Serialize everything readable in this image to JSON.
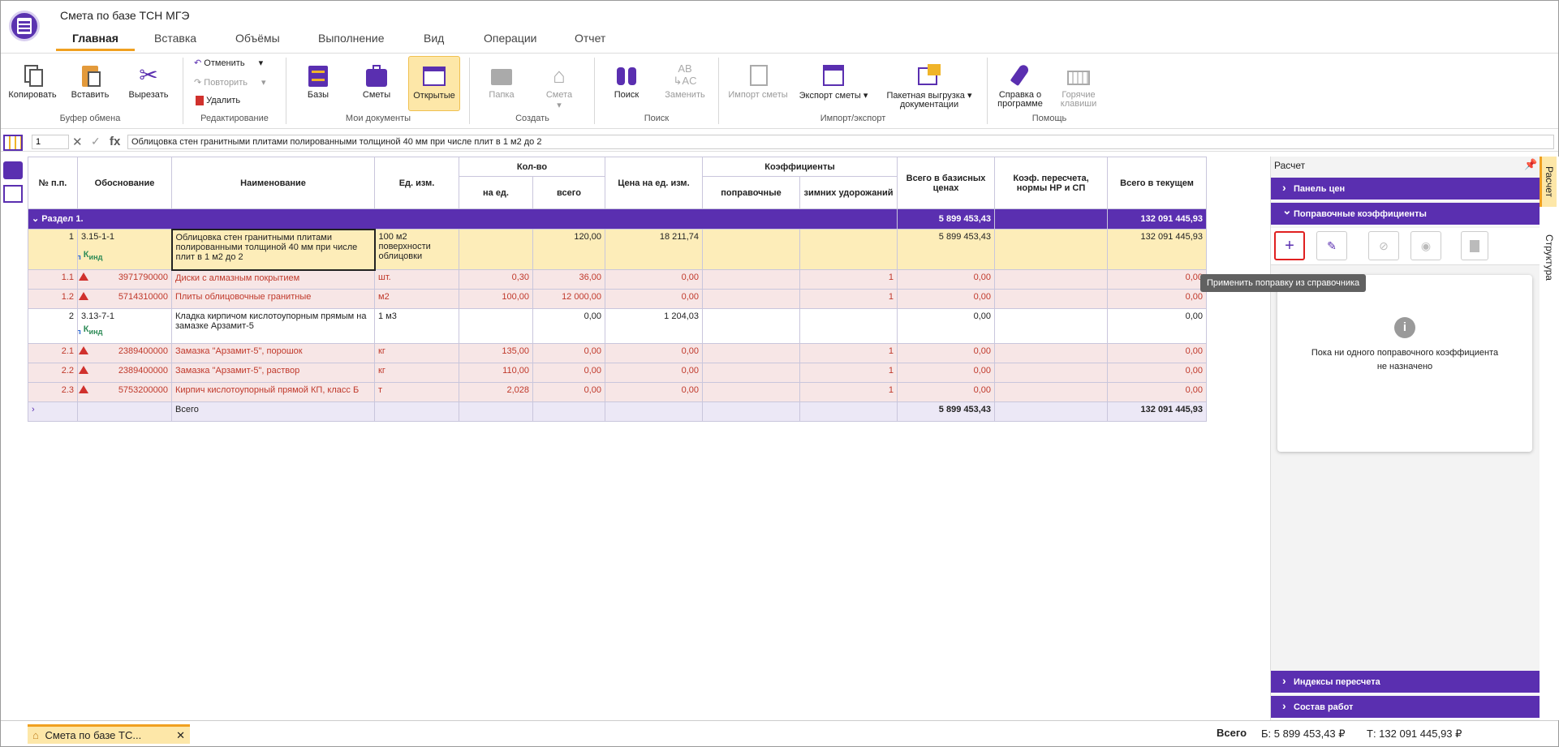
{
  "app": {
    "title": "Смета по базе ТСН МГЭ"
  },
  "tabs": [
    "Главная",
    "Вставка",
    "Объёмы",
    "Выполнение",
    "Вид",
    "Операции",
    "Отчет"
  ],
  "ribbon": {
    "copy": "Копировать",
    "paste": "Вставить",
    "cut": "Вырезать",
    "group_clipboard": "Буфер обмена",
    "undo": "Отменить",
    "redo": "Повторить",
    "delete": "Удалить",
    "group_edit": "Редактирование",
    "bases": "Базы",
    "estimates": "Сметы",
    "opened": "Открытые",
    "group_docs": "Мои документы",
    "folder": "Папка",
    "estimate": "Смета",
    "group_create": "Создать",
    "search": "Поиск",
    "replace": "Заменить",
    "group_search": "Поиск",
    "import": "Импорт сметы",
    "export": "Экспорт сметы",
    "batch1": "Пакетная выгрузка",
    "batch2": "документации",
    "group_io": "Импорт/экспорт",
    "help1": "Справка о",
    "help2": "программе",
    "hot1": "Горячие",
    "hot2": "клавиши",
    "group_help": "Помощь"
  },
  "formula": {
    "cell": "1",
    "fx": "fx",
    "text": "Облицовка стен гранитными плитами полированными толщиной 40 мм при числе плит в 1 м2 до 2"
  },
  "grid": {
    "headers": {
      "num": "№ п.п.",
      "basis": "Обоснование",
      "name": "Наименование",
      "unit": "Ед. изм.",
      "qty": "Кол-во",
      "qty_unit": "на ед.",
      "qty_total": "всего",
      "price": "Цена на ед. изм.",
      "coef": "Коэффициенты",
      "coef_corr": "поправочные",
      "coef_winter": "зимних удорожаний",
      "base_total": "Всего в базисных ценах",
      "recalc": "Коэф. пересчета, нормы НР и СП",
      "cur_total": "Всего в текущем"
    },
    "section": {
      "label": "Раздел 1.",
      "base": "5 899 453,43",
      "cur": "132 091 445,93"
    },
    "kp": "К",
    "kp_sub": "п",
    "kind": "К",
    "kind_sub": "инд",
    "rows": [
      {
        "n": "1",
        "code": "3.15-1-1",
        "name": "Облицовка стен гранитными плитами полированными толщиной 40 мм при числе плит в 1 м2 до 2",
        "unit": "100 м2 поверхности облицовки",
        "q1": "",
        "q2": "120,00",
        "price": "18 211,74",
        "c1": "",
        "c2": "",
        "base": "5 899 453,43",
        "cur": "132 091 445,93"
      },
      {
        "n": "1.1",
        "code": "3971790000",
        "name": "Диски с алмазным покрытием",
        "unit": "шт.",
        "q1": "0,30",
        "q2": "36,00",
        "price": "0,00",
        "c2": "1",
        "base": "0,00",
        "cur": "0,00"
      },
      {
        "n": "1.2",
        "code": "5714310000",
        "name": "Плиты облицовочные гранитные",
        "unit": "м2",
        "q1": "100,00",
        "q2": "12 000,00",
        "price": "0,00",
        "c2": "1",
        "base": "0,00",
        "cur": "0,00"
      },
      {
        "n": "2",
        "code": "3.13-7-1",
        "name": "Кладка кирпичом кислотоупорным прямым на замазке Арзамит-5",
        "unit": "1 м3",
        "q1": "",
        "q2": "0,00",
        "price": "1 204,03",
        "base": "0,00",
        "cur": "0,00"
      },
      {
        "n": "2.1",
        "code": "2389400000",
        "name": "Замазка \"Арзамит-5\", порошок",
        "unit": "кг",
        "q1": "135,00",
        "q2": "0,00",
        "price": "0,00",
        "c2": "1",
        "base": "0,00",
        "cur": "0,00"
      },
      {
        "n": "2.2",
        "code": "2389400000",
        "name": "Замазка \"Арзамит-5\", раствор",
        "unit": "кг",
        "q1": "110,00",
        "q2": "0,00",
        "price": "0,00",
        "c2": "1",
        "base": "0,00",
        "cur": "0,00"
      },
      {
        "n": "2.3",
        "code": "5753200000",
        "name": "Кирпич кислотоупорный прямой КП, класс Б",
        "unit": "т",
        "q1": "2,028",
        "q2": "0,00",
        "price": "0,00",
        "c2": "1",
        "base": "0,00",
        "cur": "0,00"
      }
    ],
    "total": {
      "label": "Всего",
      "base": "5 899 453,43",
      "cur": "132 091 445,93"
    }
  },
  "panel": {
    "title": "Расчет",
    "prices": "Панель цен",
    "corr": "Поправочные коэффициенты",
    "tooltip": "Применить поправку из справочника",
    "empty1": "Пока ни одного поправочного коэффициента",
    "empty2": "не назначено",
    "indexes": "Индексы пересчета",
    "works": "Состав работ"
  },
  "vtabs": [
    "Расчет",
    "Структура"
  ],
  "status": {
    "doc_tab": "Смета по базе ТС...",
    "total_label": "Всего",
    "b": "Б: 5 899 453,43 ₽",
    "t": "Т: 132 091 445,93 ₽"
  }
}
